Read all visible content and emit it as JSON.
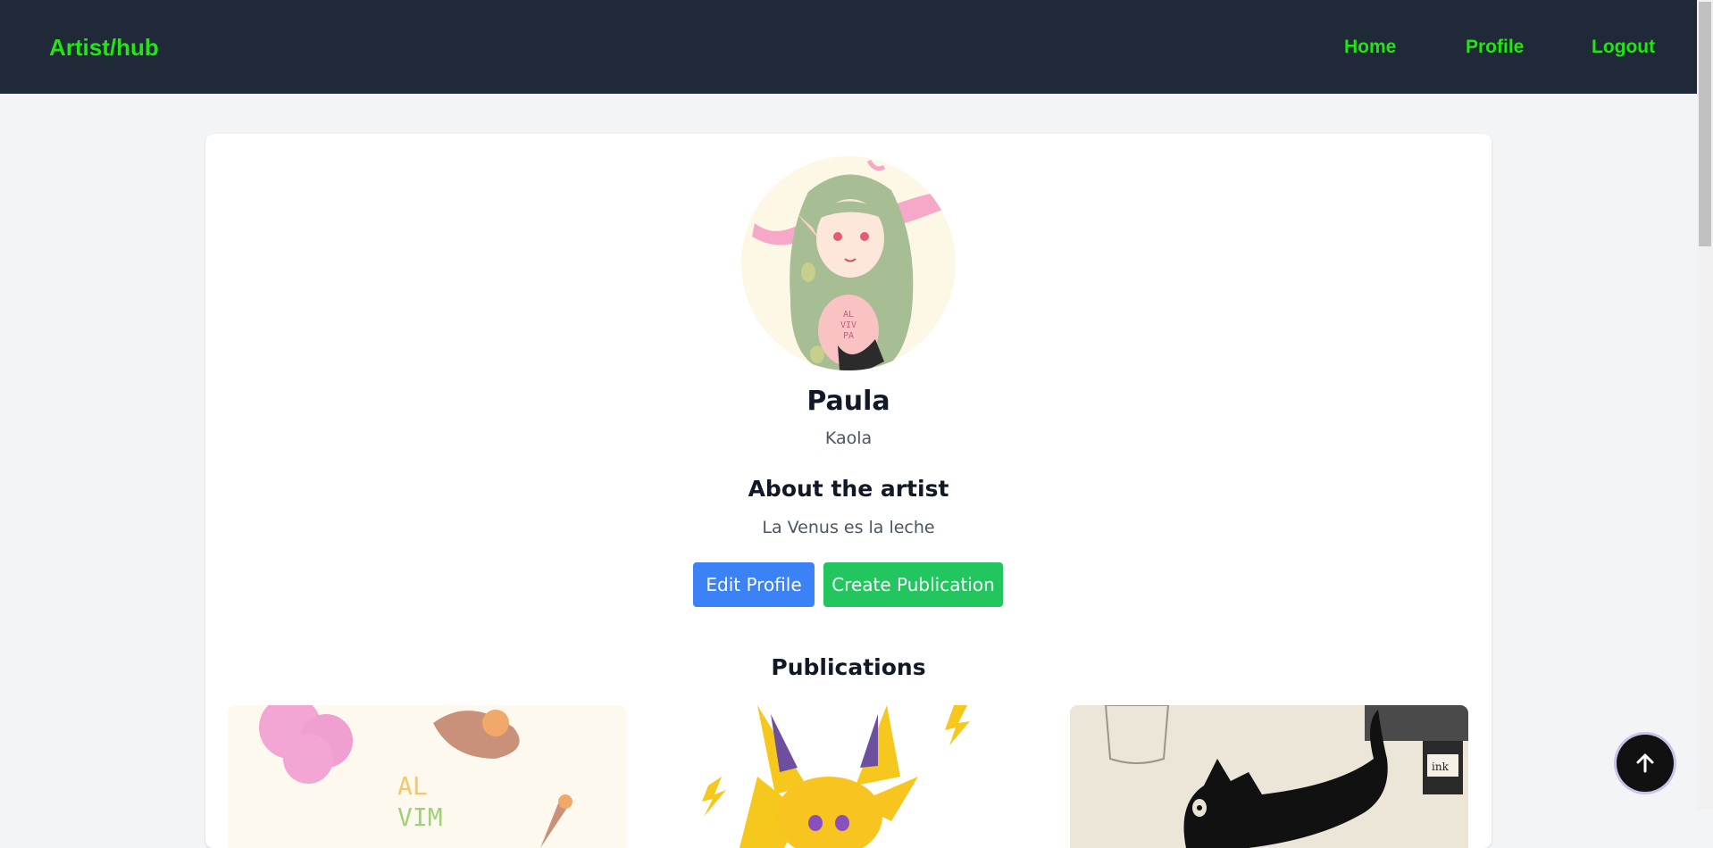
{
  "navbar": {
    "brand": "Artist/hub",
    "links": [
      {
        "label": "Home"
      },
      {
        "label": "Profile"
      },
      {
        "label": "Logout"
      }
    ],
    "background": "#1f2937",
    "accent": "#22e514"
  },
  "profile": {
    "name": "Paula",
    "username": "Kaola",
    "about_heading": "About the artist",
    "bio": "La Venus es la leche",
    "avatar_text": "AL\nVIV\nPA"
  },
  "actions": {
    "edit_label": "Edit Profile",
    "create_label": "Create Publication"
  },
  "publications": {
    "heading": "Publications",
    "items": [
      {
        "art": "pink-sheep-illustration",
        "text": "AL\nVIM"
      },
      {
        "art": "yellow-electric-creature-illustration",
        "text": ""
      },
      {
        "art": "black-cat-sketch",
        "text": "ink"
      }
    ]
  },
  "back_to_top": {
    "icon": "arrow-up-icon"
  },
  "colors": {
    "edit_button": "#3b82f6",
    "create_button": "#22c55e",
    "page_bg": "#f3f4f6"
  }
}
